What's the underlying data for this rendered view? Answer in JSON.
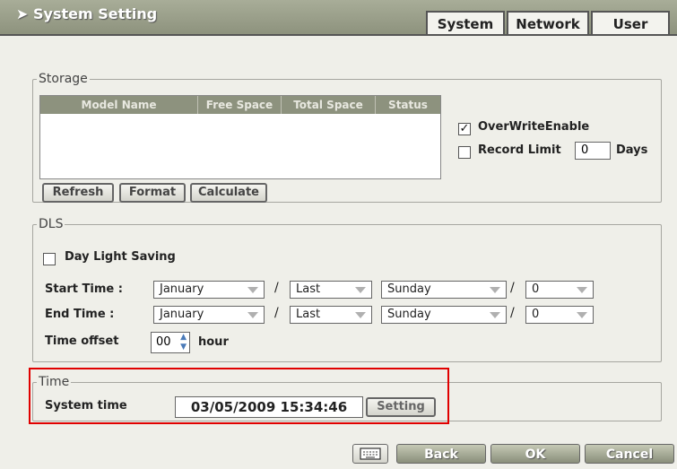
{
  "window": {
    "title": "System Setting",
    "title_arrow": "➤"
  },
  "tabs": [
    {
      "label": "System"
    },
    {
      "label": "Network"
    },
    {
      "label": "User"
    }
  ],
  "storage": {
    "legend": "Storage",
    "columns": [
      "Model Name",
      "Free Space",
      "Total Space",
      "Status"
    ],
    "rows": [],
    "overwrite_label": "OverWriteEnable",
    "overwrite_checked": true,
    "record_limit_label": "Record Limit",
    "record_limit_value": "0",
    "record_limit_unit": "Days",
    "buttons": {
      "refresh": "Refresh",
      "format": "Format",
      "calculate": "Calculate"
    }
  },
  "dls": {
    "legend": "DLS",
    "day_light_saving_label": "Day Light Saving",
    "start_label": "Start  Time :",
    "end_label": "End   Time :",
    "start": {
      "month": "January",
      "week": "Last",
      "day": "Sunday",
      "hour": "0"
    },
    "end": {
      "month": "January",
      "week": "Last",
      "day": "Sunday",
      "hour": "0"
    },
    "separator": "/",
    "offset_label": "Time offset",
    "offset_value": "00",
    "offset_unit": "hour"
  },
  "time": {
    "legend": "Time",
    "system_time_label": "System time",
    "system_time_value": "03/05/2009 15:34:46",
    "setting_button": "Setting"
  },
  "footer": {
    "keyboard_icon": "keyboard-icon",
    "back": "Back",
    "ok": "OK",
    "cancel": "Cancel"
  },
  "colors": {
    "highlight": "#e00000",
    "titlebar": "#8c917c"
  }
}
